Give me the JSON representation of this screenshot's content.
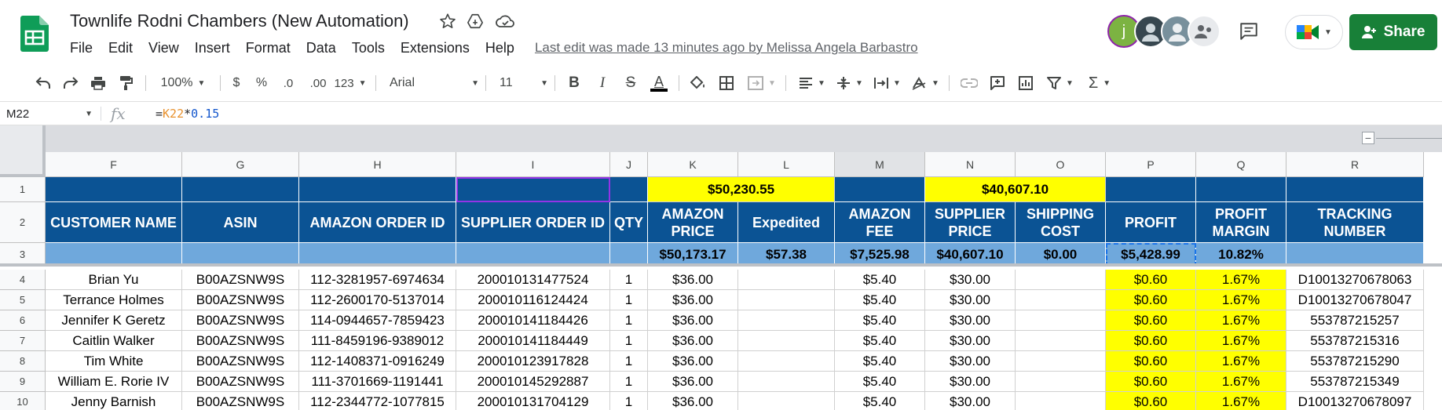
{
  "header": {
    "title": "Townlife Rodni Chambers (New Automation)",
    "menus": [
      "File",
      "Edit",
      "View",
      "Insert",
      "Format",
      "Data",
      "Tools",
      "Extensions",
      "Help"
    ],
    "last_edit": "Last edit was made 13 minutes ago by Melissa Angela Barbastro",
    "share_label": "Share",
    "avatar_initial": "j"
  },
  "toolbar": {
    "zoom": "100%",
    "currency": "$",
    "percent": "%",
    "decrease_decimal": ".0",
    "increase_decimal": ".00",
    "number_format": "123",
    "font": "Arial",
    "font_size": "11",
    "bold": "B",
    "italic": "I",
    "strike": "S",
    "text_color": "A"
  },
  "formula_bar": {
    "cell_ref": "M22",
    "fx": "fx",
    "formula_eq": "=",
    "formula_ref": "K22",
    "formula_op": "*",
    "formula_num": "0.15"
  },
  "columns": [
    "F",
    "G",
    "H",
    "I",
    "J",
    "K",
    "L",
    "M",
    "N",
    "O",
    "P",
    "Q",
    "R"
  ],
  "row_numbers": [
    "1",
    "2",
    "3",
    "4",
    "5",
    "6",
    "7",
    "8",
    "9",
    "10"
  ],
  "row1": {
    "amazon_price_total": "$50,230.55",
    "supplier_price_total": "$40,607.10"
  },
  "headers": [
    "CUSTOMER NAME",
    "ASIN",
    "AMAZON ORDER ID",
    "SUPPLIER ORDER ID",
    "QTY",
    "AMAZON PRICE",
    "Expedited",
    "AMAZON FEE",
    "SUPPLIER PRICE",
    "SHIPPING COST",
    "PROFIT",
    "PROFIT MARGIN",
    "TRACKING NUMBER"
  ],
  "totals": [
    "",
    "",
    "",
    "",
    "",
    "$50,173.17",
    "$57.38",
    "$7,525.98",
    "$40,607.10",
    "$0.00",
    "$5,428.99",
    "10.82%",
    ""
  ],
  "rows": [
    [
      "Brian Yu",
      "B00AZSNW9S",
      "112-3281957-6974634",
      "200010131477524",
      "1",
      "$36.00",
      "",
      "$5.40",
      "$30.00",
      "",
      "$0.60",
      "1.67%",
      "D10013270678063"
    ],
    [
      "Terrance Holmes",
      "B00AZSNW9S",
      "112-2600170-5137014",
      "200010116124424",
      "1",
      "$36.00",
      "",
      "$5.40",
      "$30.00",
      "",
      "$0.60",
      "1.67%",
      "D10013270678047"
    ],
    [
      "Jennifer K Geretz",
      "B00AZSNW9S",
      "114-0944657-7859423",
      "200010141184426",
      "1",
      "$36.00",
      "",
      "$5.40",
      "$30.00",
      "",
      "$0.60",
      "1.67%",
      "553787215257"
    ],
    [
      "Caitlin Walker",
      "B00AZSNW9S",
      "111-8459196-9389012",
      "200010141184449",
      "1",
      "$36.00",
      "",
      "$5.40",
      "$30.00",
      "",
      "$0.60",
      "1.67%",
      "553787215316"
    ],
    [
      "Tim White",
      "B00AZSNW9S",
      "112-1408371-0916249",
      "200010123917828",
      "1",
      "$36.00",
      "",
      "$5.40",
      "$30.00",
      "",
      "$0.60",
      "1.67%",
      "553787215290"
    ],
    [
      "William E. Rorie IV",
      "B00AZSNW9S",
      "111-3701669-1191441",
      "200010145292887",
      "1",
      "$36.00",
      "",
      "$5.40",
      "$30.00",
      "",
      "$0.60",
      "1.67%",
      "553787215349"
    ],
    [
      "Jenny Barnish",
      "B00AZSNW9S",
      "112-2344772-1077815",
      "200010131704129",
      "1",
      "$36.00",
      "",
      "$5.40",
      "$30.00",
      "",
      "$0.60",
      "1.67%",
      "D10013270678097"
    ]
  ],
  "colors": {
    "header_blue": "#0b5394",
    "summary_blue": "#6fa8dc",
    "highlight_yellow": "#ffff00",
    "share_green": "#188038",
    "sheets_green": "#0f9d58"
  }
}
